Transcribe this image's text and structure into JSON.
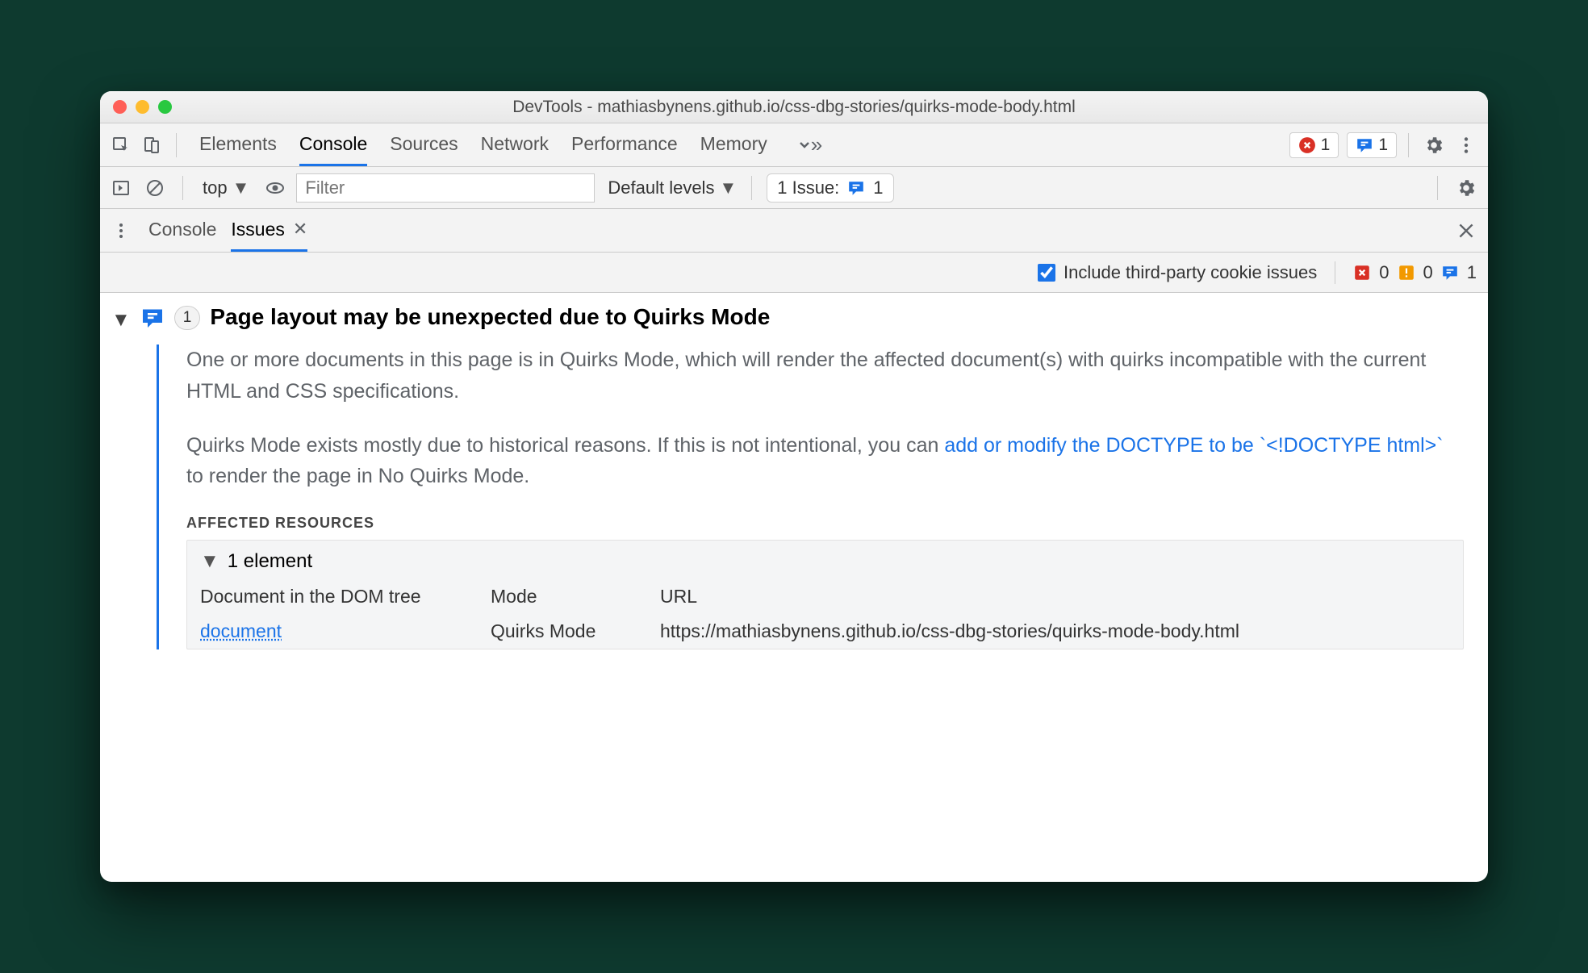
{
  "titlebar": {
    "title": "DevTools - mathiasbynens.github.io/css-dbg-stories/quirks-mode-body.html"
  },
  "mainTabs": {
    "elements": "Elements",
    "console": "Console",
    "sources": "Sources",
    "network": "Network",
    "performance": "Performance",
    "memory": "Memory"
  },
  "topBadges": {
    "errorCount": "1",
    "infoCount": "1"
  },
  "filterBar": {
    "context": "top",
    "filterPlaceholder": "Filter",
    "levels": "Default levels",
    "issueLabel": "1 Issue:",
    "issueCount": "1"
  },
  "subTabs": {
    "console": "Console",
    "issues": "Issues"
  },
  "issuesBar": {
    "includeThirdParty": "Include third-party cookie issues",
    "errCount": "0",
    "warnCount": "0",
    "infoCount": "1"
  },
  "issue": {
    "badge": "1",
    "title": "Page layout may be unexpected due to Quirks Mode",
    "para1": "One or more documents in this page is in Quirks Mode, which will render the affected document(s) with quirks incompatible with the current HTML and CSS specifications.",
    "para2a": "Quirks Mode exists mostly due to historical reasons. If this is not intentional, you can ",
    "para2link": "add or modify the DOCTYPE to be `<!DOCTYPE html>`",
    "para2b": " to render the page in No Quirks Mode.",
    "affectedLabel": "AFFECTED RESOURCES",
    "elementCount": "1 element",
    "colDoc": "Document in the DOM tree",
    "colMode": "Mode",
    "colUrl": "URL",
    "docLink": "document",
    "modeVal": "Quirks Mode",
    "urlVal": "https://mathiasbynens.github.io/css-dbg-stories/quirks-mode-body.html"
  }
}
